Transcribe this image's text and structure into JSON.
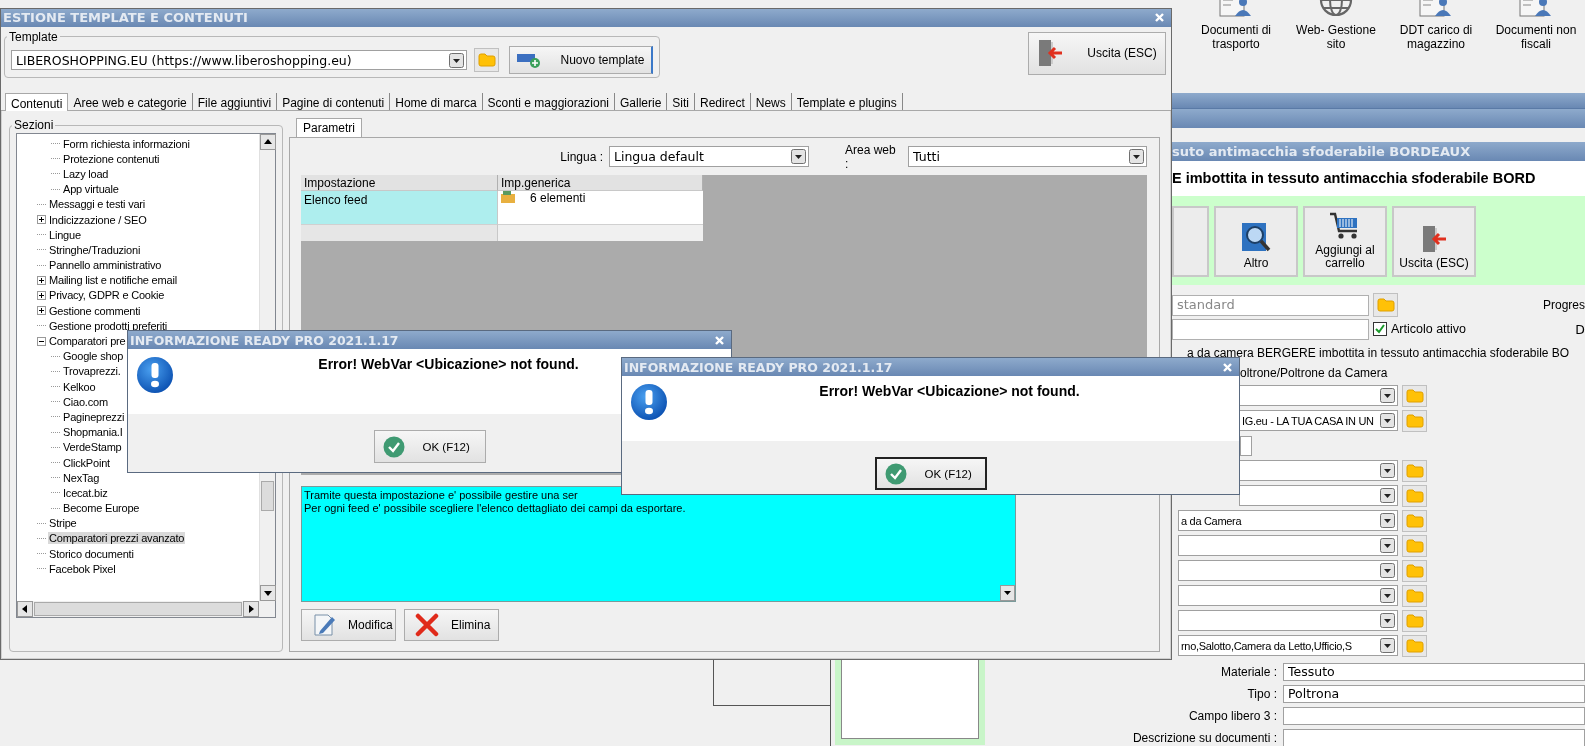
{
  "top_toolbar": [
    {
      "label": "Documenti di trasporto",
      "kind": "document"
    },
    {
      "label": "Web- Gestione sito",
      "kind": "globe"
    },
    {
      "label": "DDT carico di magazzino",
      "kind": "document"
    },
    {
      "label": "Documenti non fiscali",
      "kind": "document"
    }
  ],
  "product_window": {
    "title": "suto antimacchia sfoderabile BORDEAUX",
    "heading": "E imbottita in tessuto antimacchia sfoderabile BORD",
    "buttons": [
      {
        "label": "Altro",
        "kind": "search"
      },
      {
        "label": "Aggiungi al carrello",
        "kind": "cart"
      },
      {
        "label": "Uscita (ESC)",
        "kind": "exit"
      }
    ],
    "layout_field": "standard",
    "progress_label": "Progres",
    "active_checkbox": {
      "label": "Articolo attivo",
      "checked": true
    },
    "side_label": "D",
    "description": "a da camera BERGERE imbottita in tessuto antimacchia sfoderabile BO",
    "category": "oltrone/Poltrone da Camera",
    "dropdowns": [
      {
        "kind": "combo"
      },
      {
        "kind": "combo",
        "value": "IG.eu - LA TUA CASA IN UN"
      },
      {
        "kind": "short"
      },
      {
        "kind": "combo"
      },
      {
        "kind": "combo"
      },
      {
        "kind": "combo",
        "value": "a da Camera"
      },
      {
        "kind": "combo"
      },
      {
        "kind": "combo"
      },
      {
        "kind": "combo"
      },
      {
        "kind": "combo"
      },
      {
        "kind": "combo",
        "value": "rno,Salotto,Camera da Letto,Ufficio,S"
      }
    ],
    "fields": [
      {
        "label": "Materiale :",
        "value": "Tessuto"
      },
      {
        "label": "Tipo :",
        "value": "Poltrona"
      },
      {
        "label": "Campo libero 3 :"
      },
      {
        "label": "Descrizione su documenti :"
      }
    ]
  },
  "main_window": {
    "title": "ESTIONE TEMPLATE E CONTENUTI",
    "template_label": "Template",
    "template_value": "LIBEROSHOPPING.EU (https://www.liberoshopping.eu)",
    "new_template_button": "Nuovo template",
    "exit_button": "Uscita (ESC)",
    "tabs": [
      {
        "label": "Contenuti",
        "selected": true
      },
      {
        "label": "Aree web e categorie",
        "selected": false
      },
      {
        "label": "File aggiuntivi",
        "selected": false
      },
      {
        "label": "Pagine di contenuti",
        "selected": false
      },
      {
        "label": "Home di marca",
        "selected": false
      },
      {
        "label": "Sconti e maggiorazioni",
        "selected": false
      },
      {
        "label": "Gallerie",
        "selected": false
      },
      {
        "label": "Siti",
        "selected": false
      },
      {
        "label": "Redirect",
        "selected": false
      },
      {
        "label": "News",
        "selected": false
      },
      {
        "label": "Template e plugins",
        "selected": false
      }
    ],
    "sections_label": "Sezioni",
    "tree": [
      {
        "children": [
          {
            "label": "Form richiesta informazioni",
            "selected": false
          },
          {
            "label": "Protezione contenuti",
            "selected": false
          },
          {
            "label": "Lazy load",
            "selected": false
          },
          {
            "label": "App virtuale",
            "selected": false
          }
        ]
      },
      {
        "label": "Messaggi e testi vari",
        "selected": false
      },
      {
        "label": "Indicizzazione / SEO",
        "selected": false,
        "expanded": false
      },
      {
        "label": "Lingue",
        "selected": false
      },
      {
        "label": "Stringhe/Traduzioni",
        "selected": false
      },
      {
        "label": "Pannello amministrativo",
        "selected": false
      },
      {
        "label": "Mailing list e notifiche email",
        "selected": false,
        "expanded": false
      },
      {
        "label": "Privacy, GDPR e Cookie",
        "selected": false,
        "expanded": false
      },
      {
        "label": "Gestione commenti",
        "selected": false,
        "expanded": false
      },
      {
        "label": "Gestione prodotti preferiti",
        "selected": false
      },
      {
        "label": "Comparatori pre",
        "selected": false,
        "expanded": true,
        "children": [
          {
            "label": "Google shop",
            "selected": false
          },
          {
            "label": "Trovaprezzi.",
            "selected": false
          },
          {
            "label": "Kelkoo",
            "selected": false
          },
          {
            "label": "Ciao.com",
            "selected": false
          },
          {
            "label": "Pagineprezzi",
            "selected": false
          },
          {
            "label": "Shopmania.I",
            "selected": false
          },
          {
            "label": "VerdeStamp",
            "selected": false
          },
          {
            "label": "ClickPoint",
            "selected": false
          },
          {
            "label": "NexTag",
            "selected": false
          },
          {
            "label": "Icecat.biz",
            "selected": false
          },
          {
            "label": "Become Europe",
            "selected": false
          }
        ]
      },
      {
        "label": "Stripe",
        "selected": false
      },
      {
        "label": "Comparatori prezzi avanzato",
        "selected": true
      },
      {
        "label": "Storico documenti",
        "selected": false
      },
      {
        "label": "Facebok Pixel",
        "selected": false
      }
    ],
    "subtabs": [
      {
        "label": "Parametri",
        "selected": true
      }
    ],
    "language_label": "Lingua :",
    "language_value": "Lingua default",
    "area_label": "Area web :",
    "area_value": "Tutti",
    "grid": {
      "columns": [
        "Impostazione",
        "Imp.generica"
      ],
      "rows": [
        {
          "name": "Elenco feed",
          "value": "6 elementi",
          "selected": true
        }
      ]
    },
    "description_lines": [
      "Tramite questa impostazione e' possibile gestire una ser",
      "Per ogni feed e' possibile scegliere l'elenco dettagliato dei campi da esportare."
    ],
    "buttons": [
      {
        "label": "Modifica",
        "kind": "edit"
      },
      {
        "label": "Elimina",
        "kind": "delete"
      }
    ]
  },
  "dialogs": [
    {
      "title": "INFORMAZIONE READY PRO 2021.1.17",
      "message": "Error! WebVar <Ubicazione> not found.",
      "button": "OK (F12)",
      "focused": false
    },
    {
      "title": "INFORMAZIONE READY PRO 2021.1.17",
      "message": "Error! WebVar <Ubicazione> not found.",
      "button": "OK (F12)",
      "focused": true
    }
  ]
}
